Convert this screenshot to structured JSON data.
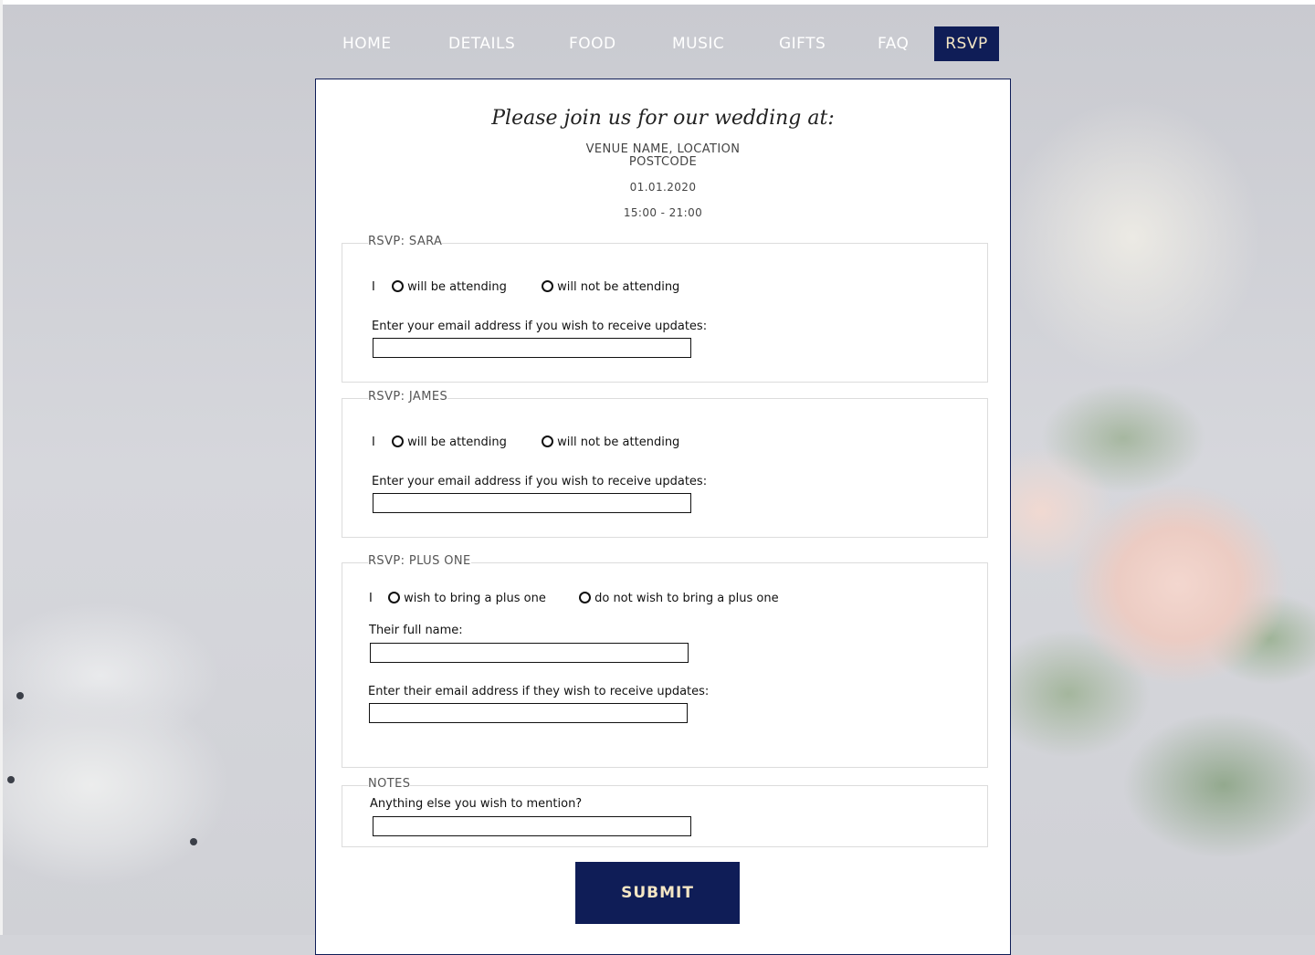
{
  "nav": {
    "items": [
      {
        "label": "HOME"
      },
      {
        "label": "DETAILS"
      },
      {
        "label": "FOOD"
      },
      {
        "label": "MUSIC"
      },
      {
        "label": "GIFTS"
      },
      {
        "label": "FAQ"
      },
      {
        "label": "RSVP",
        "active": true
      }
    ]
  },
  "invitation": {
    "heading": "Please join us for our wedding at:",
    "venue_line1": "VENUE NAME, LOCATION",
    "venue_line2": "POSTCODE",
    "date": "01.01.2020",
    "time": "15:00 - 21:00"
  },
  "rsvp_sara": {
    "legend": "RSVP: SARA",
    "prefix": "I",
    "option_yes": "will be attending",
    "option_no": "will not be attending",
    "email_label": "Enter your email address if you wish to receive updates:",
    "email_value": ""
  },
  "rsvp_james": {
    "legend": "RSVP: JAMES",
    "prefix": "I",
    "option_yes": "will be attending",
    "option_no": "will not be attending",
    "email_label": "Enter your email address if you wish to receive updates:",
    "email_value": ""
  },
  "rsvp_plus_one": {
    "legend": "RSVP: PLUS ONE",
    "prefix": "I",
    "option_yes": "wish to bring a plus one",
    "option_no": "do not wish to bring a plus one",
    "name_label": "Their full name:",
    "name_value": "",
    "email_label": "Enter their email address if they wish to receive updates:",
    "email_value": ""
  },
  "notes": {
    "legend": "NOTES",
    "label": "Anything else you wish to mention?",
    "value": ""
  },
  "submit_label": "SUBMIT",
  "colors": {
    "navy": "#0f1d57",
    "accent_text": "#f4e6c4"
  }
}
